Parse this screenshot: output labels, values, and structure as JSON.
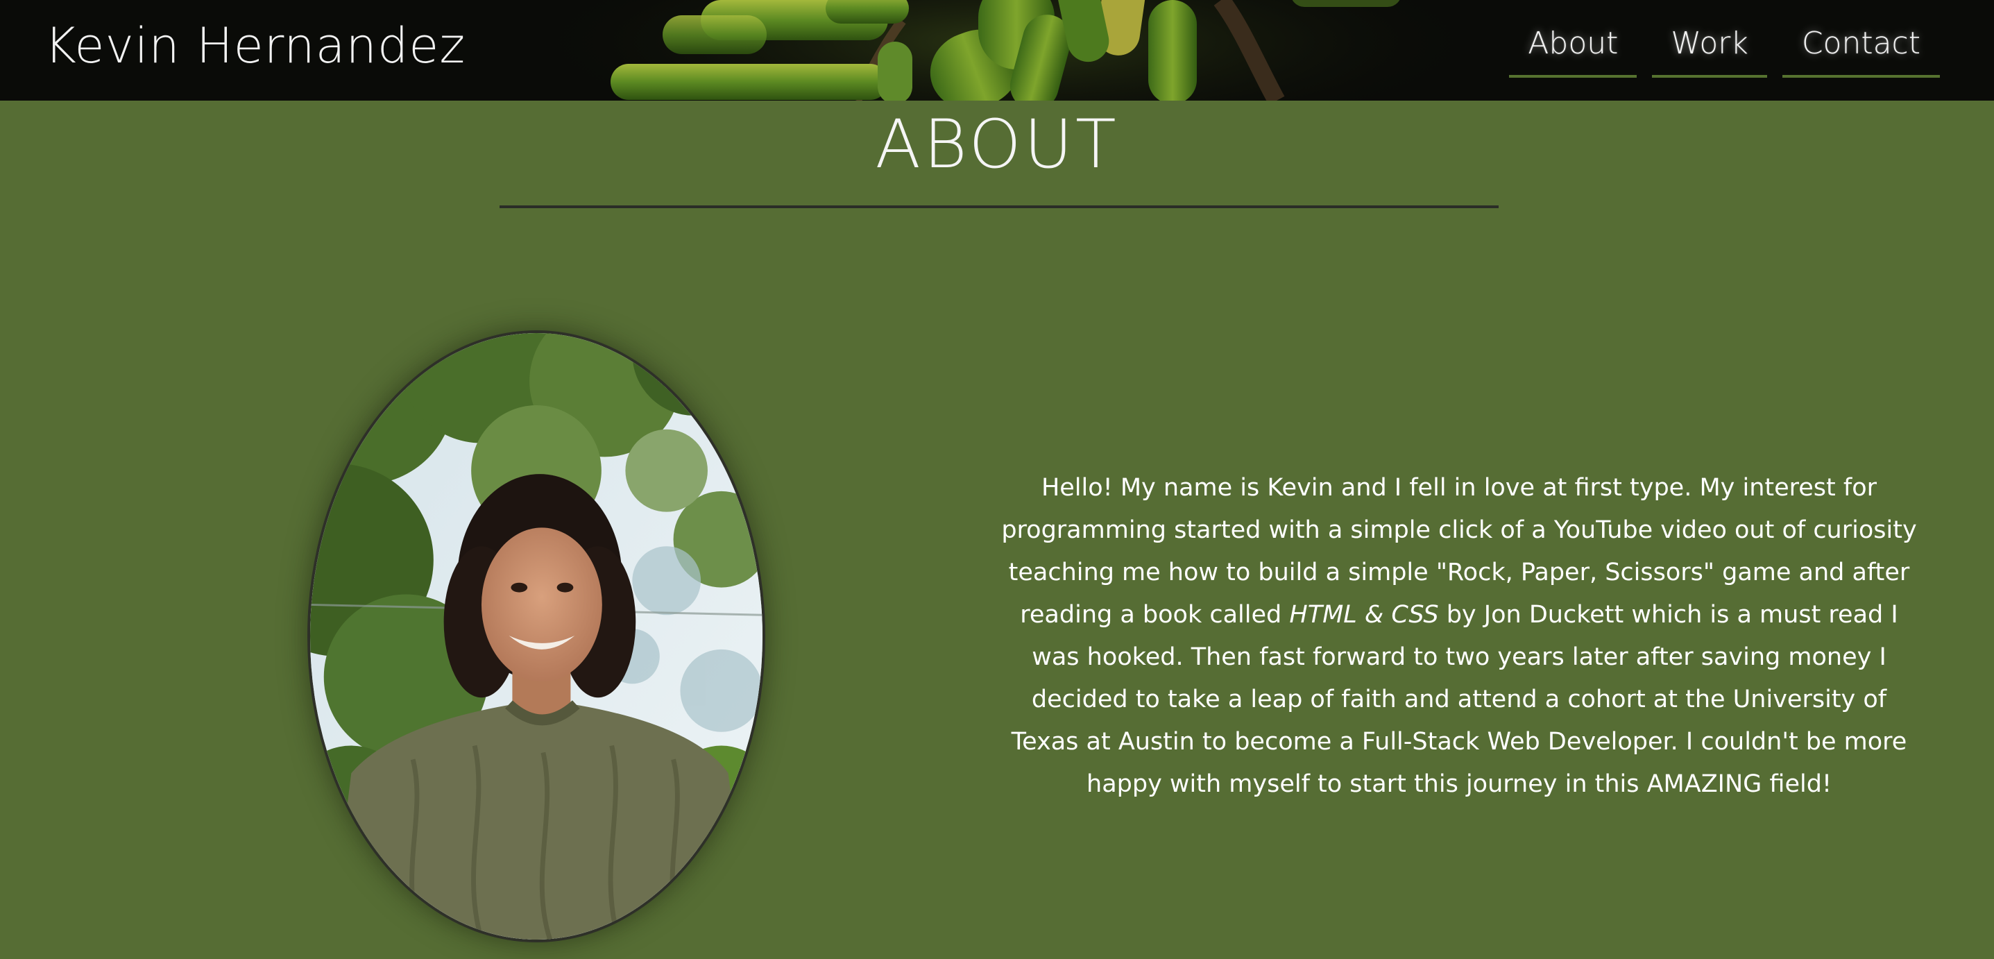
{
  "header": {
    "site_name": "Kevin Hernandez",
    "nav": [
      {
        "label": "About"
      },
      {
        "label": "Work"
      },
      {
        "label": "Contact"
      }
    ],
    "banner_image": "succulent-plant-photo"
  },
  "about": {
    "title": "ABOUT",
    "portrait_image": "portrait-photo-of-kevin",
    "bio_before_book": "Hello! My name is Kevin and I fell in love at first type. My interest for programming started with a simple click of a YouTube video out of curiosity teaching me how to build a simple \"Rock, Paper, Scissors\" game and after reading a book called ",
    "book_title": "HTML & CSS",
    "bio_after_book": " by Jon Duckett which is a must read I was hooked. Then fast forward to two years later after saving money I decided to take a leap of faith and attend a cohort at the University of Texas at Austin to become a Full-Stack Web Developer. I couldn't be more happy with myself to start this journey in this AMAZING field!"
  },
  "colors": {
    "page_background": "#566d34",
    "header_background": "#0a0b08",
    "nav_underline": "#56722f",
    "title_rule": "#2a2d27",
    "text": "#ffffff"
  }
}
